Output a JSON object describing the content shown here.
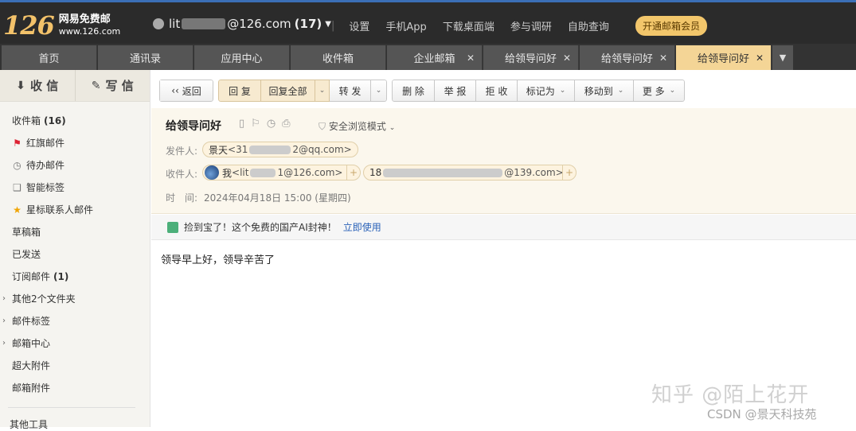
{
  "header": {
    "logo_number": "126",
    "logo_title": "网易免费邮",
    "logo_url_text": "www.126.com",
    "account_prefix": "lit",
    "account_suffix": "@126.com",
    "account_count": "(17)",
    "links": [
      "设置",
      "手机App",
      "下载桌面端",
      "参与调研",
      "自助查询"
    ],
    "vip_button": "开通邮箱会员"
  },
  "tabs": [
    {
      "label": "首页",
      "closable": false
    },
    {
      "label": "通讯录",
      "closable": false
    },
    {
      "label": "应用中心",
      "closable": false
    },
    {
      "label": "收件箱",
      "closable": false
    },
    {
      "label": "企业邮箱",
      "closable": true
    },
    {
      "label": "给领导问好",
      "closable": true
    },
    {
      "label": "给领导问好",
      "closable": true
    },
    {
      "label": "给领导问好",
      "closable": true,
      "active": true
    }
  ],
  "sidebar": {
    "receive": "收 信",
    "compose": "写 信",
    "folders": [
      {
        "label": "收件箱",
        "count": "(16)",
        "icon": "none"
      },
      {
        "label": "红旗邮件",
        "icon": "flag-icon"
      },
      {
        "label": "待办邮件",
        "icon": "clock-icon"
      },
      {
        "label": "智能标签",
        "icon": "bookmark-icon"
      },
      {
        "label": "星标联系人邮件",
        "icon": "star-icon"
      },
      {
        "label": "草稿箱",
        "icon": "none"
      },
      {
        "label": "已发送",
        "icon": "none"
      },
      {
        "label": "订阅邮件",
        "count": "(1)",
        "icon": "none"
      },
      {
        "label": "其他2个文件夹",
        "icon": "none",
        "expandable": true
      },
      {
        "label": "邮件标签",
        "icon": "none",
        "expandable": true
      },
      {
        "label": "邮箱中心",
        "icon": "none",
        "expandable": true
      },
      {
        "label": "超大附件",
        "icon": "none"
      },
      {
        "label": "邮箱附件",
        "icon": "none"
      },
      {
        "label": "其他工具",
        "icon": "none"
      }
    ]
  },
  "toolbar": {
    "back": "返回",
    "reply": "回 复",
    "reply_all": "回复全部",
    "forward": "转 发",
    "delete": "删 除",
    "report": "举 报",
    "reject": "拒 收",
    "mark_as": "标记为",
    "move_to": "移动到",
    "more": "更 多"
  },
  "message": {
    "subject": "给领导问好",
    "safe_mode": "安全浏览模式",
    "from_label": "发件人:",
    "from_name": "景天",
    "from_addr_prefix": "<31",
    "from_addr_suffix": "2@qq.com>",
    "to_label": "收件人:",
    "to1_name": "我",
    "to1_addr_prefix": "<lit",
    "to1_addr_suffix": "1@126.com>",
    "to2_prefix": "18",
    "to2_suffix": "@139.com>",
    "time_label": "时　间:",
    "time_value": "2024年04月18日 15:00 (星期四)",
    "body": "领导早上好，领导辛苦了"
  },
  "promo": {
    "text": "捡到宝了！这个免费的国产AI封神！",
    "link": "立即使用"
  },
  "watermark": {
    "zhihu": "知乎 @陌上花开",
    "csdn": "CSDN @景天科技苑"
  },
  "colors": {
    "active_tab": "#f4d596",
    "vip_button": "#f2c66b",
    "header_bg": "#2b2b2b",
    "link": "#2a62b8"
  }
}
